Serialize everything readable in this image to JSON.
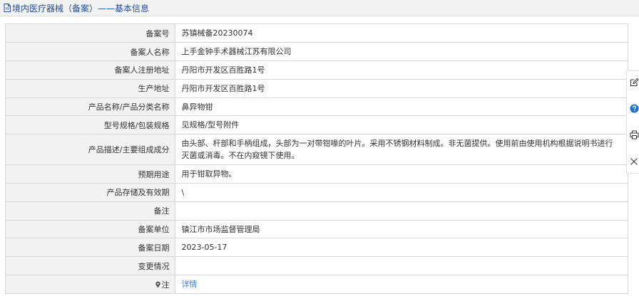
{
  "header": {
    "title": "境内医疗器械（备案）——基本信息"
  },
  "rows": [
    {
      "label": "备案号",
      "value": "苏镇械备20230074"
    },
    {
      "label": "备案人名称",
      "value": "上手金钟手术器械江苏有限公司"
    },
    {
      "label": "备案人注册地址",
      "value": "丹阳市开发区百胜路1号"
    },
    {
      "label": "生产地址",
      "value": "丹阳市开发区百胜路1号"
    },
    {
      "label": "产品名称/产品分类名称",
      "value": "鼻异物钳"
    },
    {
      "label": "型号规格/包装规格",
      "value": "见规格/型号附件"
    },
    {
      "label": "产品描述/主要组成成分",
      "value": "由头部、杆部和手柄组成，头部为一对带钳喙的叶片。采用不锈钢材料制成。非无菌提供。使用前由使用机构根据说明书进行灭菌或消毒。不在内窥镜下使用。"
    },
    {
      "label": "预期用途",
      "value": "用于钳取异物。"
    },
    {
      "label": "产品存储及有效期",
      "value": "\\"
    },
    {
      "label": "备注",
      "value": ""
    },
    {
      "label": "备案单位",
      "value": "镇江市市场监督管理局"
    },
    {
      "label": "备案日期",
      "value": "2023-05-17"
    },
    {
      "label": "变更情况",
      "value": ""
    },
    {
      "label": "注",
      "value": "详情"
    }
  ],
  "toolbar": {
    "icons": [
      "edit-icon",
      "help-icon",
      "print-icon",
      "close-icon"
    ]
  },
  "colors": {
    "title": "#1f4e9a",
    "link": "#3d7fd0",
    "label_bg": "#f2f2f2",
    "border": "#d6d6d6",
    "help_icon": "#1f6fc6"
  }
}
